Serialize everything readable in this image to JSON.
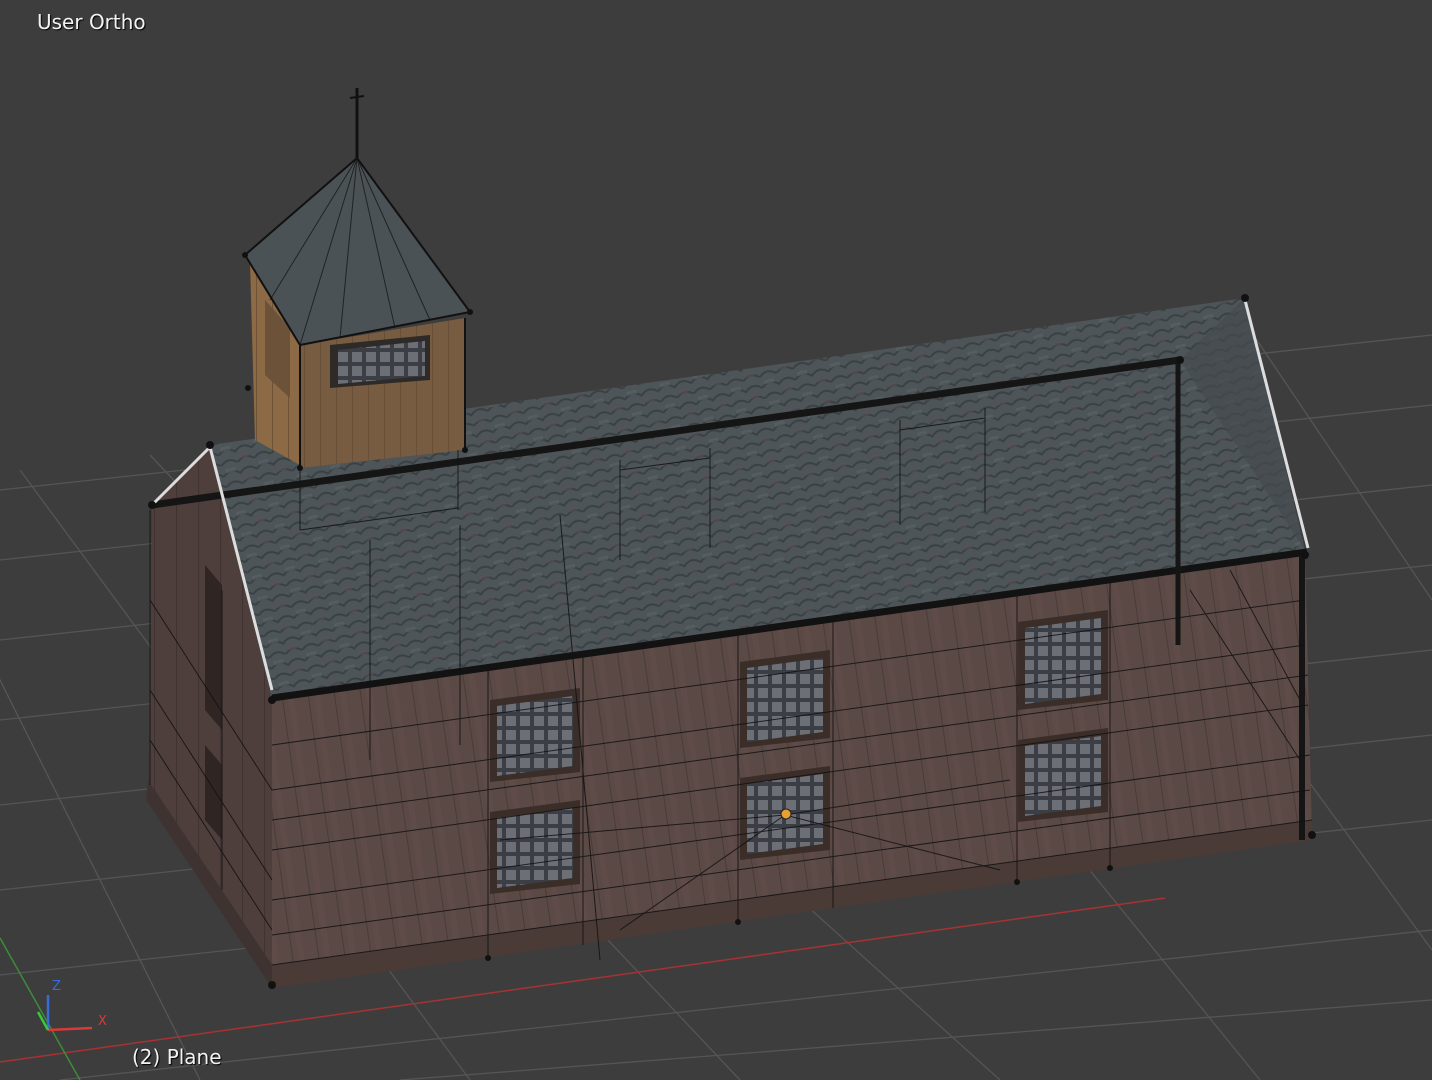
{
  "viewport": {
    "view_label": "User Ortho",
    "object_label": "(2) Plane",
    "mode": "3D view, wireframe overlay on textured model",
    "background_color": "#3d3d3d",
    "grid_color": "#5a5a5a",
    "x_axis_color": "#b03030",
    "y_axis_color": "#3f8f3f"
  },
  "axis_gizmo": {
    "z": "Z",
    "x": "X",
    "z_color": "#3a6ad8",
    "x_color": "#d83a3a",
    "y_color": "#3ac83a"
  },
  "model": {
    "name": "Plane",
    "walls_color": "#5a4a45",
    "roof_color": "#4f5659",
    "cupola_color": "#9a7548",
    "window_count": 7,
    "origin_marker_color": "#e8a030"
  }
}
